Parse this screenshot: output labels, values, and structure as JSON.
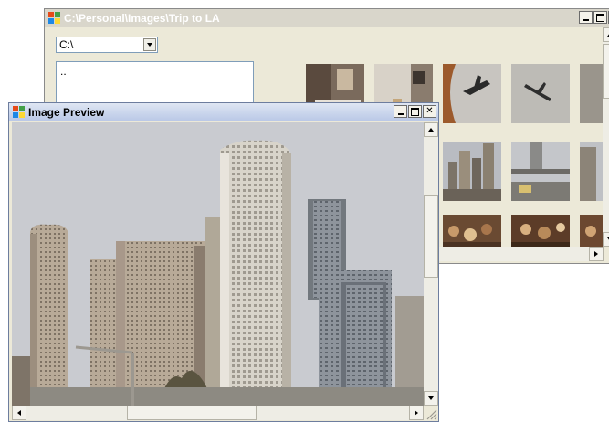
{
  "browser": {
    "title": "C:\\Personal\\Images\\Trip to LA",
    "drive": "C:\\",
    "folders": [
      ".."
    ],
    "title_icon": "app-icon",
    "thumbnails": [
      {
        "name": "hotel-room",
        "row": 0
      },
      {
        "name": "hotel-room-lamp",
        "row": 0
      },
      {
        "name": "plane-window-view",
        "row": 0
      },
      {
        "name": "plane-in-sky",
        "row": 0
      },
      {
        "name": "plane-partial",
        "row": 0
      },
      {
        "name": "sign-dark",
        "row": 1
      },
      {
        "name": "sign-dark-2",
        "row": 1
      },
      {
        "name": "downtown-skyline",
        "row": 1
      },
      {
        "name": "highway-overpass",
        "row": 1
      },
      {
        "name": "city-street",
        "row": 1
      },
      {
        "name": "crowd-1",
        "row": 2
      },
      {
        "name": "crowd-2",
        "row": 2
      },
      {
        "name": "crowd-3",
        "row": 2
      },
      {
        "name": "crowd-4",
        "row": 2
      },
      {
        "name": "crowd-5",
        "row": 2
      }
    ]
  },
  "preview": {
    "title": "Image Preview",
    "image": "los-angeles-skyline"
  },
  "colors": {
    "window_bg": "#ece9d8",
    "inactive_title": "#d9d6cb",
    "active_title": "#c3cfea"
  }
}
